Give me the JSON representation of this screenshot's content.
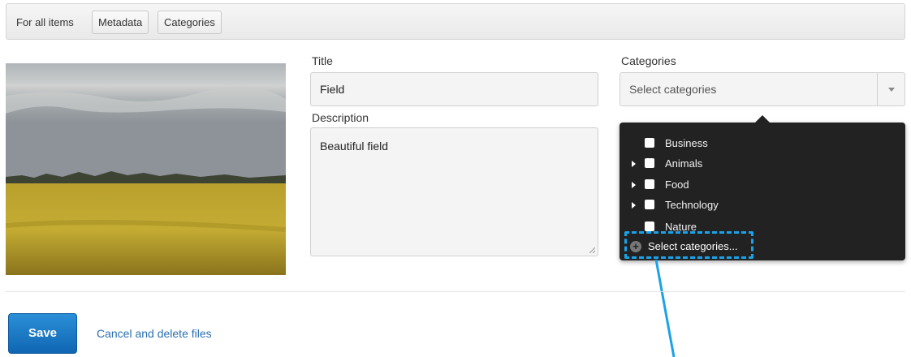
{
  "toolbar": {
    "scope_label": "For all items",
    "buttons": [
      "Metadata",
      "Categories"
    ]
  },
  "form": {
    "title_label": "Title",
    "title_value": "Field",
    "description_label": "Description",
    "description_value": "Beautiful field",
    "categories_label": "Categories",
    "categories_placeholder": "Select categories"
  },
  "dropdown": {
    "items": [
      {
        "label": "Business",
        "expandable": false
      },
      {
        "label": "Animals",
        "expandable": true
      },
      {
        "label": "Food",
        "expandable": true
      },
      {
        "label": "Technology",
        "expandable": true
      },
      {
        "label": "Nature",
        "expandable": false
      }
    ],
    "add_label": "Select categories..."
  },
  "footer": {
    "save_label": "Save",
    "cancel_label": "Cancel and delete files"
  },
  "colors": {
    "accent": "#1a73c4",
    "highlight": "#1aa3e8",
    "dropdown_bg": "#222222"
  }
}
